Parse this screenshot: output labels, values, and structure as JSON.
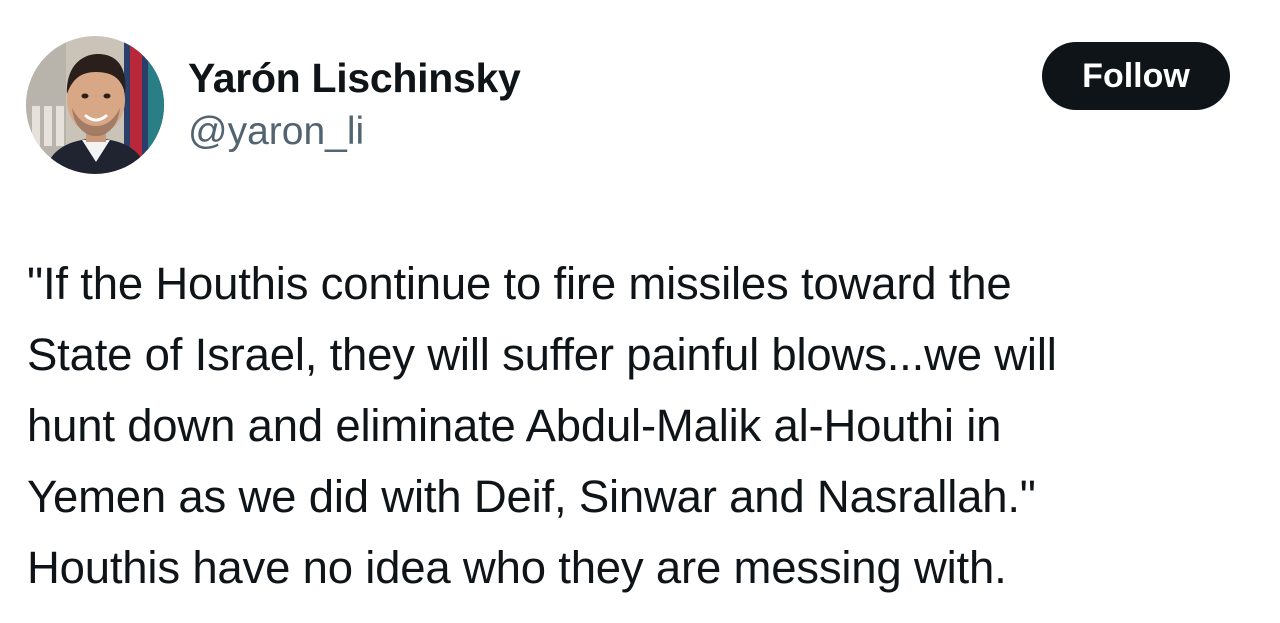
{
  "author": {
    "display_name": "Yarón Lischinsky",
    "handle": "@yaron_li",
    "avatar_icon": "profile-photo"
  },
  "follow_button": {
    "label": "Follow"
  },
  "tweet": {
    "lines": [
      "\"If the Houthis continue to fire missiles toward the",
      "State of Israel, they will suffer painful blows...we will",
      "hunt down and eliminate Abdul-Malik al-Houthi in",
      "Yemen as we did with Deif, Sinwar and Nasrallah.\"",
      "Houthis have no idea who they are messing with."
    ]
  },
  "colors": {
    "text": "#0f1419",
    "secondary_text": "#536471",
    "button_bg": "#0f1419",
    "button_text": "#ffffff",
    "background": "#ffffff"
  }
}
